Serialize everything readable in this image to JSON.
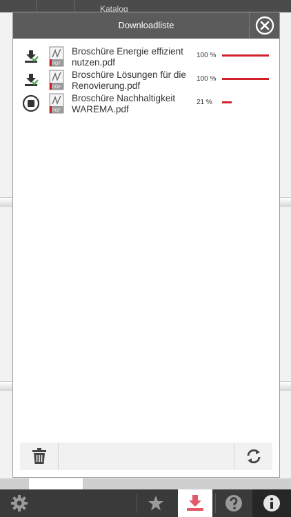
{
  "background": {
    "title": "Katalog"
  },
  "modal": {
    "title": "Downloadliste",
    "close_icon": "close-circle-icon",
    "items": [
      {
        "name": "Broschüre Energie effizient nutzen.pdf",
        "status": "completed",
        "status_icon": "download-done-icon",
        "percent_label": "100 %",
        "progress": 1.0
      },
      {
        "name": "Broschüre Lösungen für die Renovierung.pdf",
        "status": "completed",
        "status_icon": "download-done-icon",
        "percent_label": "100 %",
        "progress": 1.0
      },
      {
        "name": "Broschüre Nachhaltigkeit WAREMA.pdf",
        "status": "downloading",
        "status_icon": "stop-icon",
        "percent_label": "21 %",
        "progress": 0.21
      }
    ],
    "file_icon": "pdf-file-icon",
    "footer": {
      "delete_icon": "trash-icon",
      "refresh_icon": "refresh-icon"
    }
  },
  "tabbar": {
    "tabs": [
      {
        "id": "settings",
        "icon": "gear-icon"
      },
      {
        "id": "favorites",
        "icon": "star-icon"
      },
      {
        "id": "downloads",
        "icon": "download-icon",
        "active": true
      },
      {
        "id": "help",
        "icon": "help-icon"
      },
      {
        "id": "info",
        "icon": "info-icon"
      }
    ]
  },
  "colors": {
    "accent": "#d0202a",
    "header": "#5b5b5b",
    "tabbar": "#3a3a3a",
    "done_green": "#4caf50"
  }
}
